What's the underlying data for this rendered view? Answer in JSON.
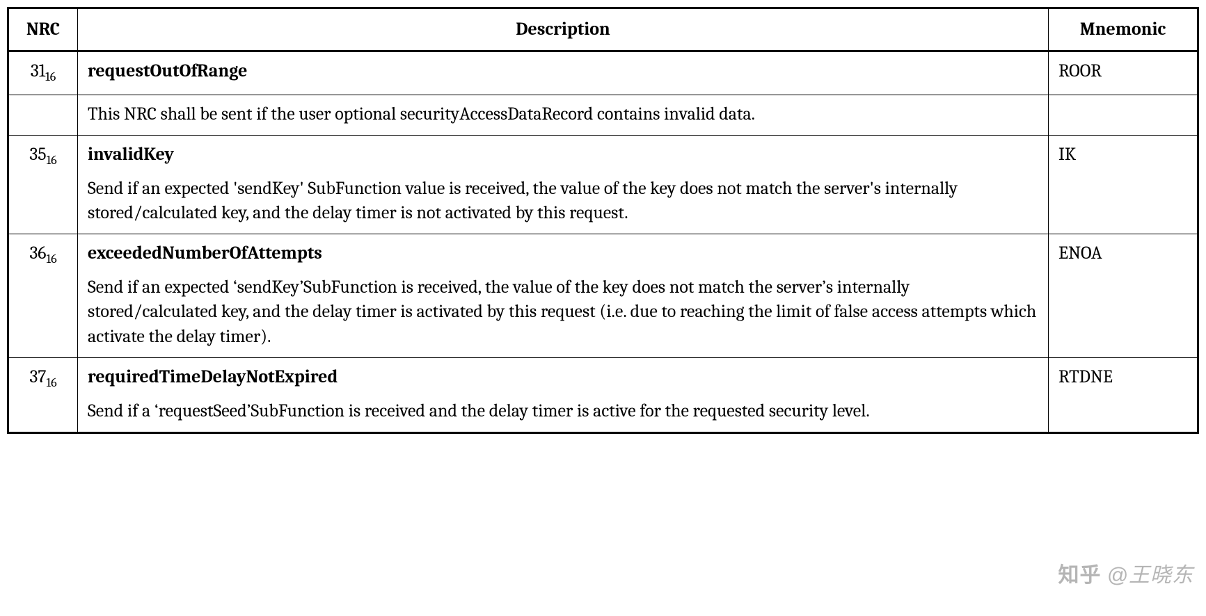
{
  "headers": {
    "nrc": "NRC",
    "description": "Description",
    "mnemonic": "Mnemonic"
  },
  "hex_suffix": "16",
  "rows": [
    {
      "nrc": "31",
      "title": "requestOutOfRange",
      "body": "This NRC shall be sent if the user optional securityAccessDataRecord contains invalid data.",
      "mnemonic": "ROOR",
      "split": true
    },
    {
      "nrc": "35",
      "title": "invalidKey",
      "body": "Send if an expected 'sendKey' SubFunction value is received, the value of the key does not match the server's internally stored/calculated key, and the delay timer is not activated by this request.",
      "mnemonic": "IK",
      "split": false
    },
    {
      "nrc": "36",
      "title": "exceededNumberOfAttempts",
      "body": "Send if an expected ‘sendKey’SubFunction is received, the value of the key does not match the server’s internally stored/calculated key, and the delay timer is activated by this request (i.e. due to reaching the limit of false access attempts which activate the delay timer).",
      "mnemonic": "ENOA",
      "split": false
    },
    {
      "nrc": "37",
      "title": "requiredTimeDelayNotExpired",
      "body": "Send if a ‘requestSeed’SubFunction is received and the delay timer is active for the requested security level.",
      "mnemonic": "RTDNE",
      "split": false
    }
  ],
  "watermark": {
    "logo": "知乎",
    "text": "@王晓东"
  }
}
